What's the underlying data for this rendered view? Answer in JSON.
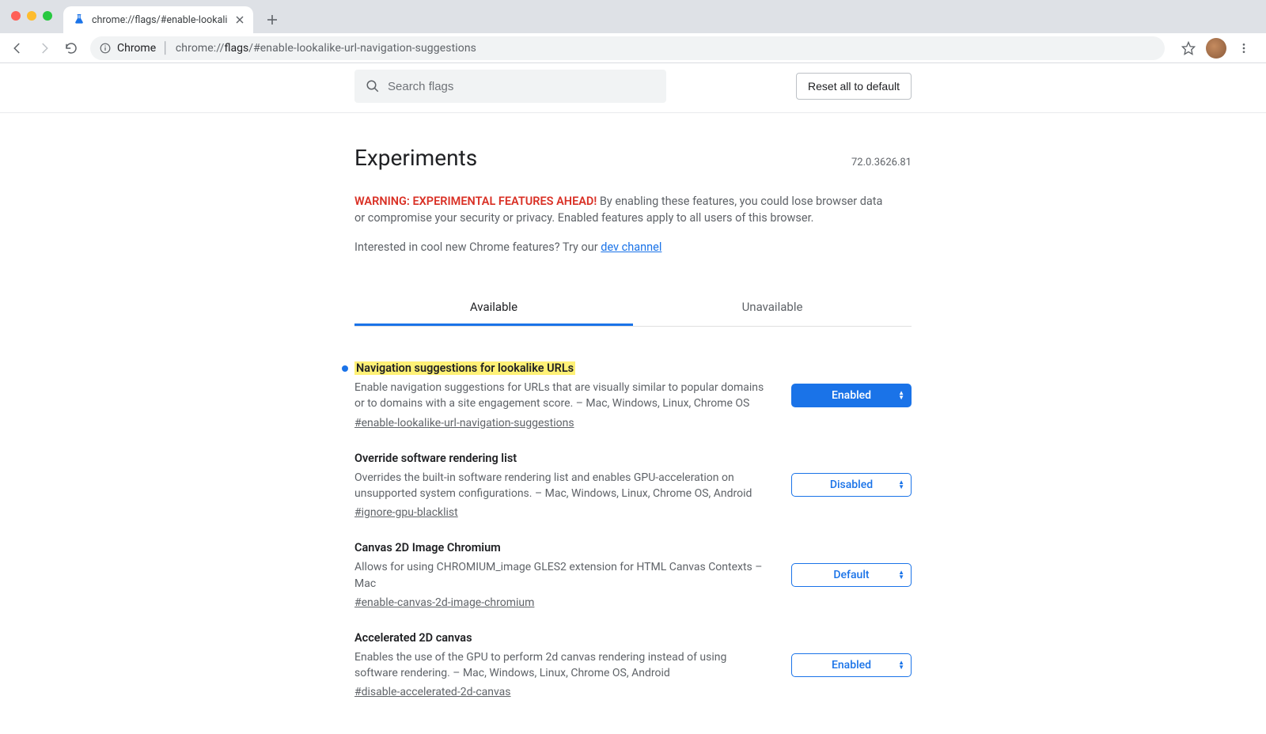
{
  "window": {
    "tab_title": "chrome://flags/#enable-lookali"
  },
  "toolbar": {
    "chrome_word": "Chrome",
    "url_scheme": "chrome://",
    "url_host": "flags",
    "url_path": "/#enable-lookalike-url-navigation-suggestions"
  },
  "search": {
    "placeholder": "Search flags"
  },
  "buttons": {
    "reset": "Reset all to default"
  },
  "header": {
    "title": "Experiments",
    "version": "72.0.3626.81",
    "warning_lead": "WARNING: EXPERIMENTAL FEATURES AHEAD!",
    "warning_body": " By enabling these features, you could lose browser data or compromise your security or privacy. Enabled features apply to all users of this browser.",
    "interested_pre": "Interested in cool new Chrome features? Try our ",
    "interested_link": "dev channel"
  },
  "tabs": {
    "available": "Available",
    "unavailable": "Unavailable"
  },
  "flags": [
    {
      "title": "Navigation suggestions for lookalike URLs",
      "highlight": true,
      "modified": true,
      "desc": "Enable navigation suggestions for URLs that are visually similar to popular domains or to domains with a site engagement score. – Mac, Windows, Linux, Chrome OS",
      "anchor": "#enable-lookalike-url-navigation-suggestions",
      "value": "Enabled",
      "style": "solid"
    },
    {
      "title": "Override software rendering list",
      "highlight": false,
      "modified": false,
      "desc": "Overrides the built-in software rendering list and enables GPU-acceleration on unsupported system configurations. – Mac, Windows, Linux, Chrome OS, Android",
      "anchor": "#ignore-gpu-blacklist",
      "value": "Disabled",
      "style": "outline"
    },
    {
      "title": "Canvas 2D Image Chromium",
      "highlight": false,
      "modified": false,
      "desc": "Allows for using CHROMIUM_image GLES2 extension for HTML Canvas Contexts – Mac",
      "anchor": "#enable-canvas-2d-image-chromium",
      "value": "Default",
      "style": "outline"
    },
    {
      "title": "Accelerated 2D canvas",
      "highlight": false,
      "modified": false,
      "desc": "Enables the use of the GPU to perform 2d canvas rendering instead of using software rendering. – Mac, Windows, Linux, Chrome OS, Android",
      "anchor": "#disable-accelerated-2d-canvas",
      "value": "Enabled",
      "style": "outline"
    }
  ]
}
